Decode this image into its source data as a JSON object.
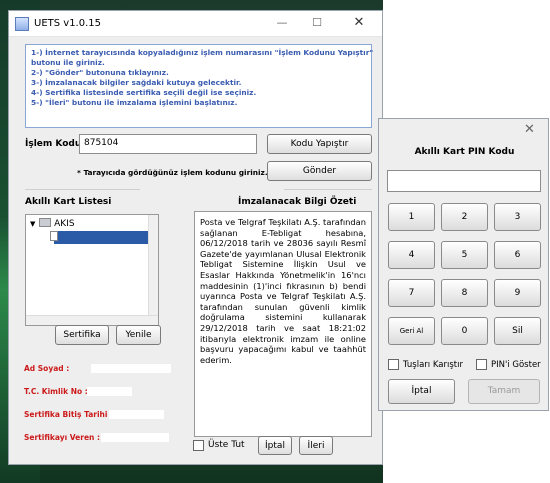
{
  "main": {
    "title": "UETS v1.0.15",
    "instructions": [
      "1-) İnternet tarayıcısında kopyaladığınız işlem numarasını \"İşlem Kodunu Yapıştır\"",
      "butonu ile giriniz.",
      "2-) \"Gönder\" butonuna tıklayınız.",
      "3-) İmzalanacak bilgiler sağdaki kutuya gelecektir.",
      "4-) Sertifika listesinde sertifika seçili değil ise seçiniz.",
      "5-) \"İleri\" butonu ile imzalama işlemini başlatınız."
    ],
    "islem_kodu_label": "İşlem Kodu",
    "islem_kodu_value": "875104",
    "paste_button": "Kodu Yapıştır",
    "hint": "* Tarayıcıda gördüğünüz işlem kodunu giriniz.",
    "send_button": "Gönder",
    "card_list_label": "Akıllı Kart Listesi",
    "tree_root": "AKIS",
    "cert_button": "Sertifika",
    "refresh_button": "Yenile",
    "info": {
      "name_label": "Ad Soyad :",
      "tc_label": "T.C. Kimlik No :",
      "expiry_label": "Sertifika Bitiş Tarihi :",
      "issuer_label": "Sertifikayı Veren :"
    },
    "summary_label": "İmzalanacak Bilgi Özeti",
    "summary_text": "Posta ve Telgraf Teşkilatı A.Ş. tarafından sağlanan E-Tebligat hesabına, 06/12/2018 tarih ve 28036 sayılı Resmî Gazete'de yayımlanan Ulusal Elektronik Tebligat Sistemine İlişkin Usul ve Esaslar Hakkında Yönetmelik'in 16'ncı maddesinin (1)'inci fıkrasının b) bendi uyarınca Posta ve Telgraf Teşkilatı A.Ş. tarafından sunulan güvenli kimlik doğrulama sistemini kullanarak 29/12/2018 tarih ve saat 18:21:02 itibarıyla elektronik imzam ile online başvuru yapacağımı kabul ve taahhüt ederim.",
    "always_on_top": "Üste Tut",
    "cancel_button": "İptal",
    "next_button": "İleri"
  },
  "pin": {
    "title": "Akıllı Kart PIN Kodu",
    "keys": [
      "1",
      "2",
      "3",
      "4",
      "5",
      "6",
      "7",
      "8",
      "9",
      "Geri Al",
      "0",
      "Sil"
    ],
    "shuffle_label": "Tuşları Karıştır",
    "show_pin_label": "PIN'i Göster",
    "cancel_button": "İptal",
    "ok_button": "Tamam"
  }
}
